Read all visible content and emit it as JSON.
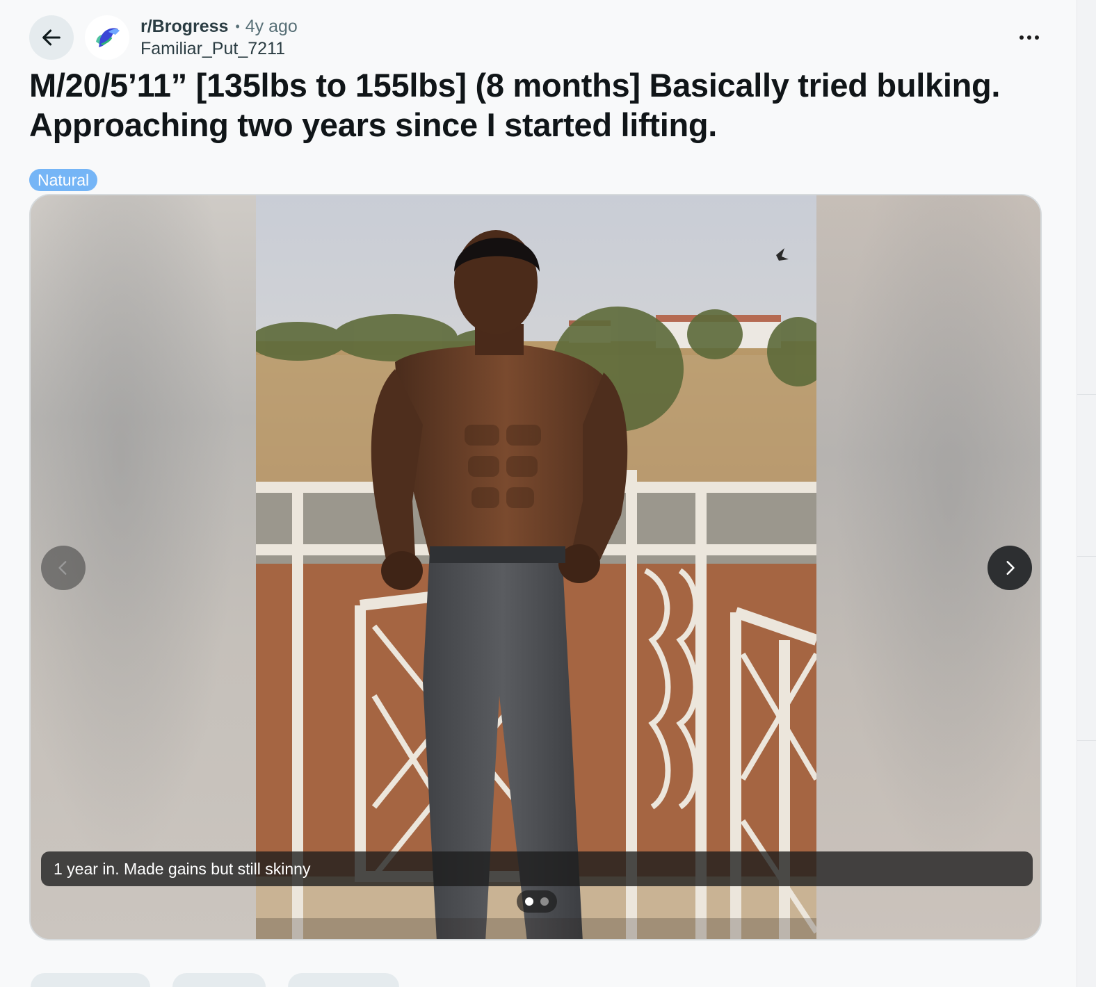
{
  "header": {
    "subreddit": "r/Brogress",
    "separator": "•",
    "age": "4y ago",
    "author": "Familiar_Put_7211"
  },
  "post": {
    "title": "M/20/5’11” [135lbs to 155lbs] (8 months] Basically tried bulking. Approaching two years since I started lifting.",
    "flair": "Natural",
    "flair_color": "#75b5f6"
  },
  "gallery": {
    "caption": "1 year in. Made gains but still skinny",
    "current_index": 1,
    "total": 2
  },
  "icons": {
    "back": "arrow-left-icon",
    "more": "ellipsis-icon",
    "prev": "chevron-left-icon",
    "next": "chevron-right-icon"
  }
}
